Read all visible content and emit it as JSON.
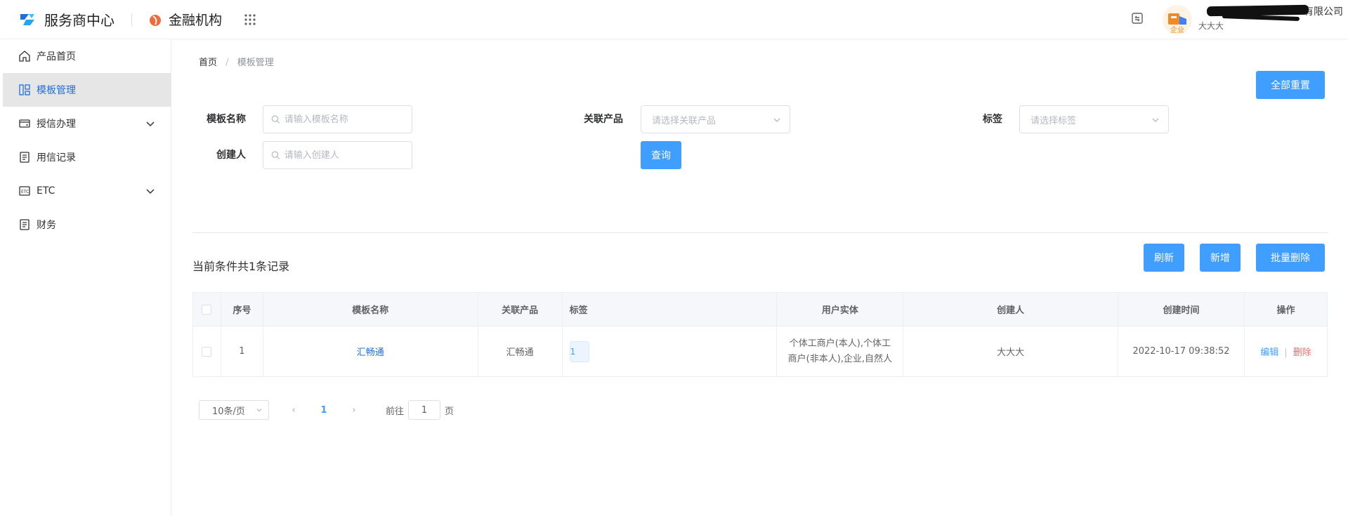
{
  "header": {
    "app_title": "服务商中心",
    "org_title": "金融机构",
    "company_name_suffix": "有限公司",
    "avatar_badge": "企业",
    "user_name": "大大大"
  },
  "sidebar": {
    "items": [
      {
        "label": "产品首页",
        "icon": "home-icon",
        "expandable": false,
        "active": false
      },
      {
        "label": "模板管理",
        "icon": "template-icon",
        "expandable": false,
        "active": true
      },
      {
        "label": "授信办理",
        "icon": "credit-card-icon",
        "expandable": true,
        "active": false
      },
      {
        "label": "用信记录",
        "icon": "document-icon",
        "expandable": false,
        "active": false
      },
      {
        "label": "ETC",
        "icon": "etc-icon",
        "expandable": true,
        "active": false
      },
      {
        "label": "财务",
        "icon": "document-icon",
        "expandable": false,
        "active": false
      }
    ]
  },
  "breadcrumb": {
    "home": "首页",
    "separator": "/",
    "current": "模板管理"
  },
  "toolbar": {
    "reset_all": "全部重置",
    "query": "查询",
    "refresh": "刷新",
    "add": "新增",
    "batch_delete": "批量删除"
  },
  "filters": {
    "template_name": {
      "label": "模板名称",
      "placeholder": "请输入模板名称",
      "value": ""
    },
    "related_product": {
      "label": "关联产品",
      "placeholder": "请选择关联产品"
    },
    "tag": {
      "label": "标签",
      "placeholder": "请选择标签"
    },
    "creator": {
      "label": "创建人",
      "placeholder": "请输入创建人",
      "value": ""
    }
  },
  "record_count": "当前条件共1条记录",
  "table": {
    "columns": [
      "",
      "序号",
      "模板名称",
      "关联产品",
      "标签",
      "用户实体",
      "创建人",
      "创建时间",
      "操作"
    ],
    "rows": [
      {
        "index": "1",
        "template_name": "汇畅通",
        "product": "汇畅通",
        "tag": "1",
        "entity_line1": "个体工商户(本人),个体工",
        "entity_line2": "商户(非本人),企业,自然人",
        "creator": "大大大",
        "created_at": "2022-10-17 09:38:52",
        "edit": "编辑",
        "delete": "删除",
        "op_separator": "|"
      }
    ]
  },
  "pagination": {
    "page_size": "10条/页",
    "current_page": "1",
    "prev": "‹",
    "next": "›",
    "goto_label": "前往",
    "goto_value": "1",
    "page_suffix": "页"
  },
  "colors": {
    "primary": "#409eff",
    "link": "#1f6fe0",
    "danger": "#f56c6c",
    "active_bg": "#e6e6e6"
  }
}
